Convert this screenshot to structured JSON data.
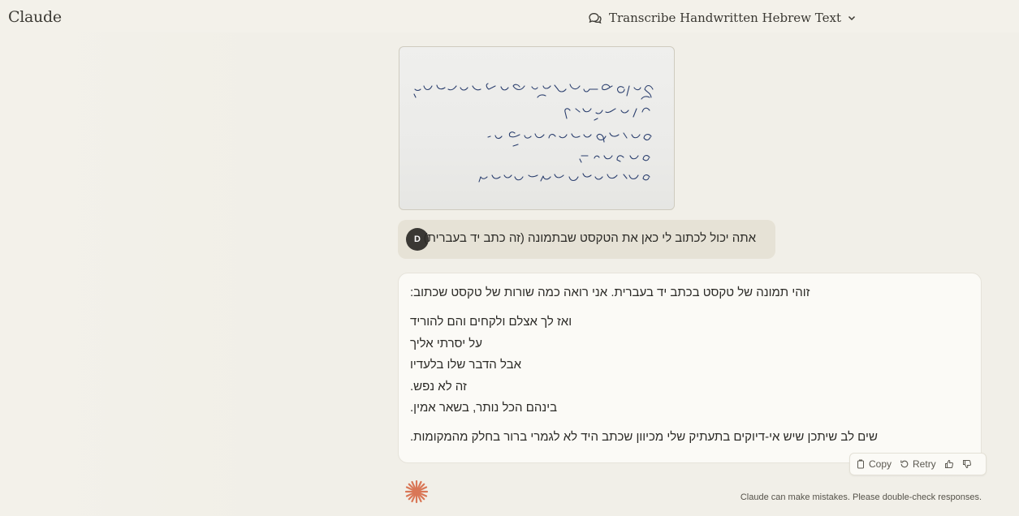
{
  "app": {
    "brand": "Claude"
  },
  "header": {
    "title": "Transcribe Handwritten Hebrew Text"
  },
  "conversation": {
    "user": {
      "avatar_initial": "D",
      "message": "אתה יכול לכתוב לי כאן את הטקסט שבתמונה (זה כתב יד בעברית)"
    },
    "assistant": {
      "intro": "זוהי תמונה של טקסט בכתב יד בעברית. אני רואה כמה שורות של טקסט שכתוב:",
      "lines": [
        "ואז לך אצלם ולקחים והם להוריד",
        "על יסרתי אליך",
        "אבל הדבר שלו בלעדיו",
        "זה לא נפש.",
        "בינהם הכל נותר, בשאר אמין."
      ],
      "note": "שים לב שיתכן שיש אי-דיוקים בתעתיק שלי מכיוון שכתב היד לא לגמרי ברור בחלק מהמקומות."
    }
  },
  "actions": {
    "copy": "Copy",
    "retry": "Retry"
  },
  "footer": {
    "disclaimer": "Claude can make mistakes. Please double-check responses."
  },
  "colors": {
    "accent": "#d97757",
    "background": "#f3f1ea",
    "ink": "#2b3f6e"
  },
  "icons": [
    "chat-bubbles-icon",
    "chevron-down-icon",
    "copy-icon",
    "retry-icon",
    "thumbs-up-icon",
    "thumbs-down-icon",
    "claude-spark-icon"
  ]
}
